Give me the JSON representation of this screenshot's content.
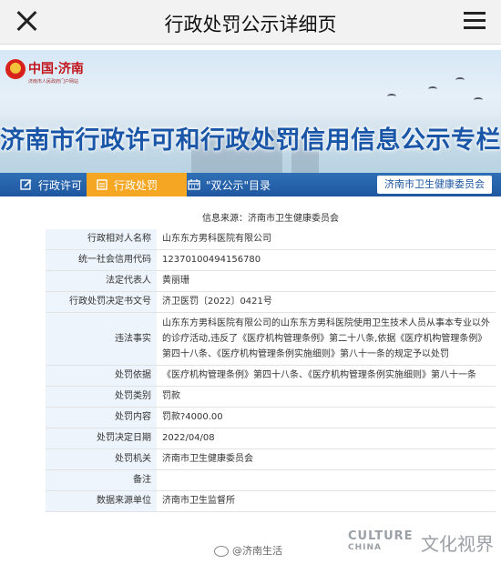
{
  "appbar": {
    "title": "行政处罚公示详细页"
  },
  "banner": {
    "logo_text": "中国·济南",
    "logo_sub": "济南市人民政府门户网站",
    "headline": "济南市行政许可和行政处罚信用信息公示专栏"
  },
  "nav": {
    "items": [
      {
        "label": "行政许可",
        "icon": "edit-icon"
      },
      {
        "label": "行政处罚",
        "icon": "clipboard-icon",
        "active": true
      },
      {
        "label": "\"双公示\"目录",
        "icon": "calendar-icon"
      }
    ],
    "department": "济南市卫生健康委员会"
  },
  "source": "信息来源：济南市卫生健康委员会",
  "rows": [
    {
      "label": "行政相对人名称",
      "value": "山东东方男科医院有限公司"
    },
    {
      "label": "统一社会信用代码",
      "value": "12370100494156780"
    },
    {
      "label": "法定代表人",
      "value": "黄丽珊"
    },
    {
      "label": "行政处罚决定书文号",
      "value": "济卫医罚〔2022〕0421号"
    },
    {
      "label": "违法事实",
      "value": "山东东方男科医院有限公司的山东东方男科医院使用卫生技术人员从事本专业以外的诊疗活动,违反了《医疗机构管理条例》第二十八条,依据《医疗机构管理条例》第四十八条、《医疗机构管理条例实施细则》第八十一条的规定予以处罚"
    },
    {
      "label": "处罚依据",
      "value": "《医疗机构管理条例》第四十八条、《医疗机构管理条例实施细则》第八十一条"
    },
    {
      "label": "处罚类别",
      "value": "罚款"
    },
    {
      "label": "处罚内容",
      "value": "罚款?4000.00"
    },
    {
      "label": "处罚决定日期",
      "value": "2022/04/08"
    },
    {
      "label": "处罚机关",
      "value": "济南市卫生健康委员会"
    },
    {
      "label": "备注",
      "value": ""
    },
    {
      "label": "数据来源单位",
      "value": "济南市卫生监督所"
    }
  ],
  "watermark": {
    "weibo": "@济南生活",
    "culture_en_1": "CULTURE",
    "culture_en_2": "CHINA",
    "culture_cn": "文化视界"
  }
}
